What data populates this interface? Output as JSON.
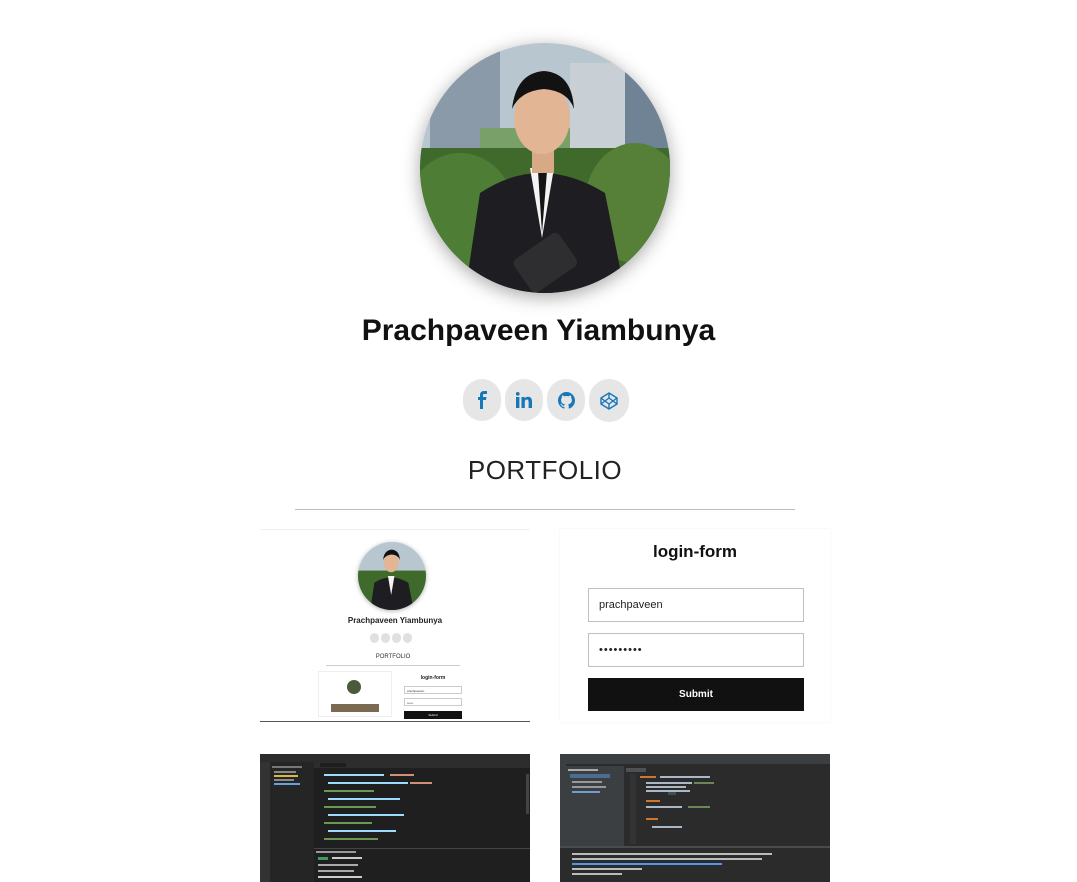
{
  "profile": {
    "name": "Prachpaveen Yiambunya",
    "socials": [
      {
        "label": "f",
        "icon": "facebook-icon",
        "color": "#1877b8"
      },
      {
        "label": "in",
        "icon": "linkedin-icon",
        "color": "#1877b8"
      },
      {
        "label": "github",
        "icon": "github-icon",
        "color": "#1877b8"
      },
      {
        "label": "codepen",
        "icon": "codepen-icon",
        "color": "#1877b8"
      }
    ]
  },
  "portfolio": {
    "title": "PORTFOLIO",
    "preview": {
      "name": "Prachpaveen Yiambunya",
      "title": "PORTFOLIO",
      "login_title": "login-form",
      "username": "prachpaveen",
      "password": "••••••",
      "submit": "Submit"
    },
    "login_form": {
      "title": "login-form",
      "username_value": "prachpaveen",
      "password_value": "•••••••••",
      "submit_label": "Submit"
    }
  },
  "colors": {
    "accent": "#1877b8",
    "button_bg": "#111111",
    "social_bg": "#e6e6e6"
  }
}
